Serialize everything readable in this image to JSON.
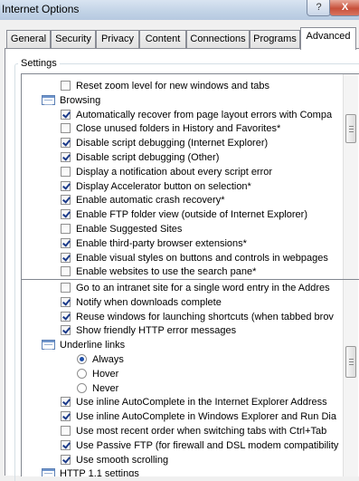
{
  "window": {
    "title": "Internet Options",
    "help_glyph": "?",
    "close_glyph": "X"
  },
  "tabs": [
    {
      "label": "General",
      "active": false
    },
    {
      "label": "Security",
      "active": false
    },
    {
      "label": "Privacy",
      "active": false
    },
    {
      "label": "Content",
      "active": false
    },
    {
      "label": "Connections",
      "active": false
    },
    {
      "label": "Programs",
      "active": false
    },
    {
      "label": "Advanced",
      "active": true
    }
  ],
  "settings": {
    "group_label": "Settings",
    "upper_list": [
      {
        "kind": "checkbox",
        "checked": false,
        "label": "Reset zoom level for new windows and tabs"
      },
      {
        "kind": "folder",
        "label": "Browsing"
      },
      {
        "kind": "checkbox",
        "checked": true,
        "label": "Automatically recover from page layout errors with Compa"
      },
      {
        "kind": "checkbox",
        "checked": false,
        "label": "Close unused folders in History and Favorites*"
      },
      {
        "kind": "checkbox",
        "checked": true,
        "label": "Disable script debugging (Internet Explorer)"
      },
      {
        "kind": "checkbox",
        "checked": true,
        "label": "Disable script debugging (Other)"
      },
      {
        "kind": "checkbox",
        "checked": false,
        "label": "Display a notification about every script error"
      },
      {
        "kind": "checkbox",
        "checked": true,
        "label": "Display Accelerator button on selection*"
      },
      {
        "kind": "checkbox",
        "checked": true,
        "label": "Enable automatic crash recovery*"
      },
      {
        "kind": "checkbox",
        "checked": true,
        "label": "Enable FTP folder view (outside of Internet Explorer)"
      },
      {
        "kind": "checkbox",
        "checked": false,
        "label": "Enable Suggested Sites"
      },
      {
        "kind": "checkbox",
        "checked": true,
        "label": "Enable third-party browser extensions*"
      },
      {
        "kind": "checkbox",
        "checked": true,
        "label": "Enable visual styles on buttons and controls in webpages"
      },
      {
        "kind": "checkbox",
        "checked": false,
        "label": "Enable websites to use the search pane*"
      }
    ],
    "lower_list": [
      {
        "kind": "checkbox",
        "checked": false,
        "label": "Go to an intranet site for a single word entry in the Addres"
      },
      {
        "kind": "checkbox",
        "checked": true,
        "label": "Notify when downloads complete"
      },
      {
        "kind": "checkbox",
        "checked": true,
        "label": "Reuse windows for launching shortcuts (when tabbed brov"
      },
      {
        "kind": "checkbox",
        "checked": true,
        "label": "Show friendly HTTP error messages"
      },
      {
        "kind": "folder",
        "label": "Underline links"
      },
      {
        "kind": "radio",
        "checked": true,
        "label": "Always"
      },
      {
        "kind": "radio",
        "checked": false,
        "label": "Hover"
      },
      {
        "kind": "radio",
        "checked": false,
        "label": "Never"
      },
      {
        "kind": "checkbox",
        "checked": true,
        "label": "Use inline AutoComplete in the Internet Explorer Address"
      },
      {
        "kind": "checkbox",
        "checked": true,
        "label": "Use inline AutoComplete in Windows Explorer and Run Dia"
      },
      {
        "kind": "checkbox",
        "checked": false,
        "label": "Use most recent order when switching tabs with Ctrl+Tab"
      },
      {
        "kind": "checkbox",
        "checked": true,
        "label": "Use Passive FTP (for firewall and DSL modem compatibility"
      },
      {
        "kind": "checkbox",
        "checked": true,
        "label": "Use smooth scrolling"
      },
      {
        "kind": "folder",
        "label": "HTTP 1.1 settings"
      }
    ]
  }
}
